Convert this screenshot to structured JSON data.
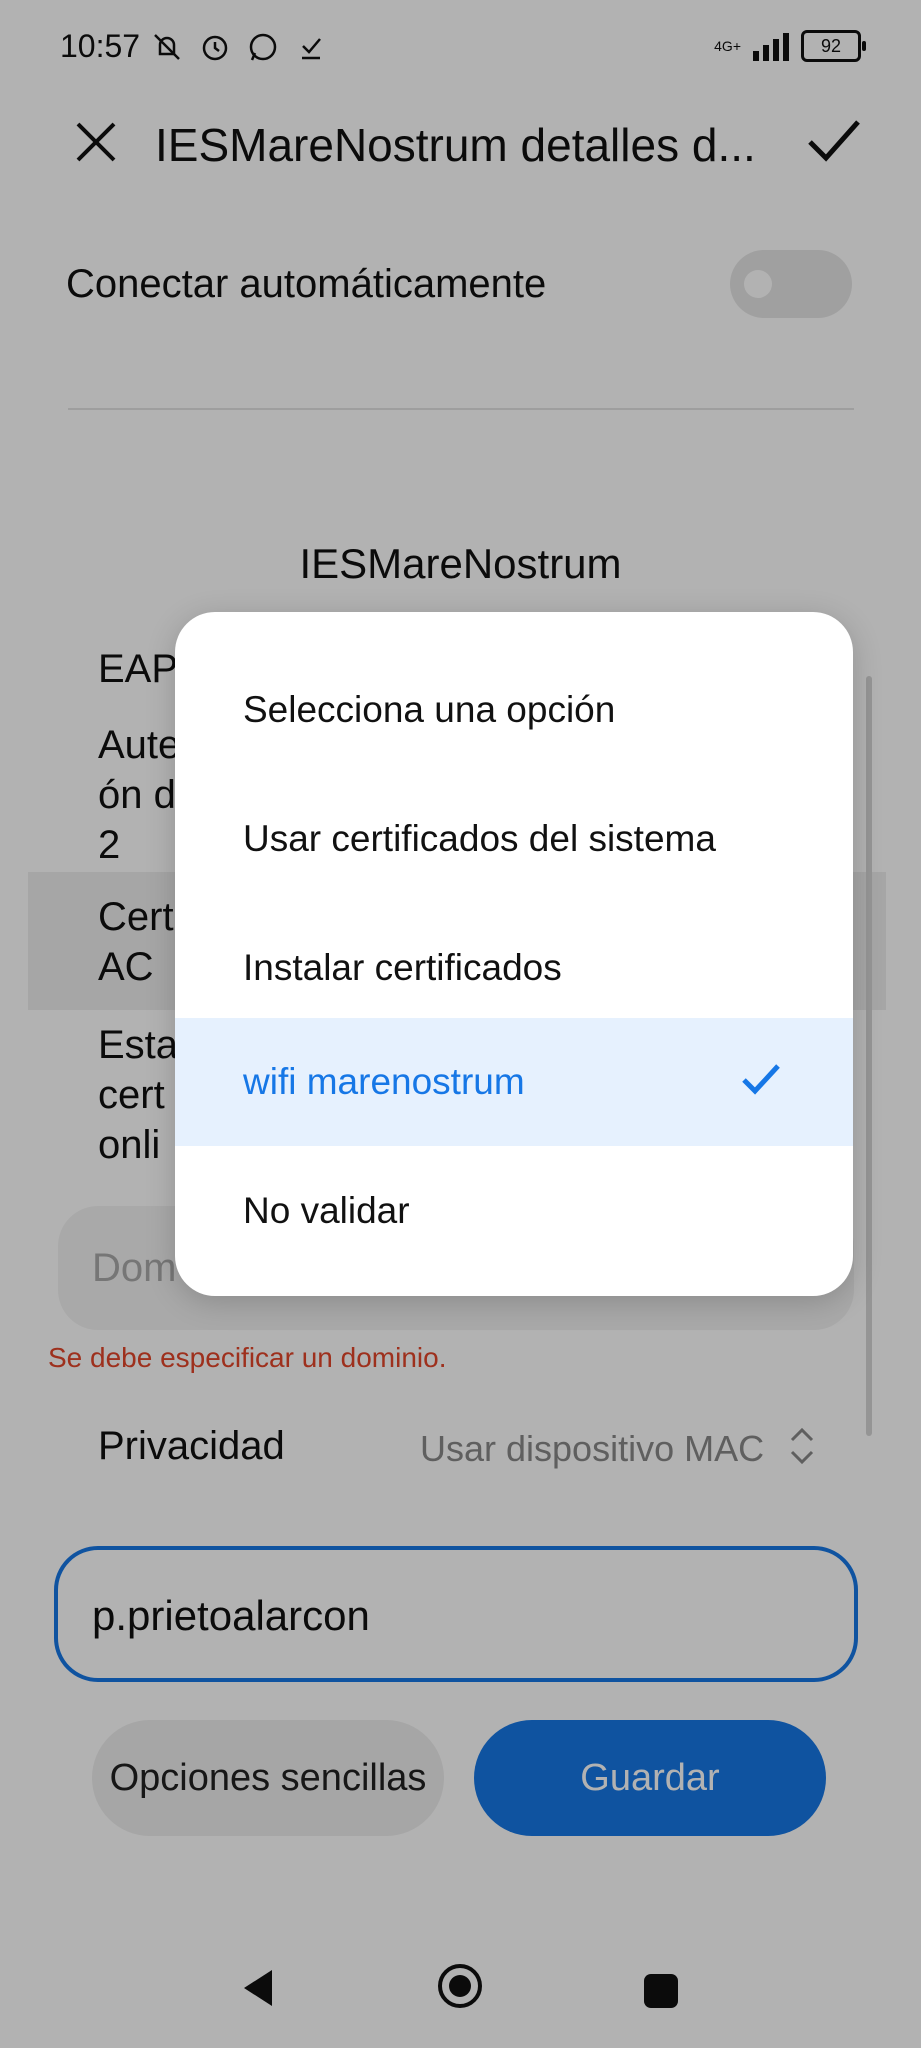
{
  "status_bar": {
    "time": "10:57",
    "network": "4G+",
    "battery": "92",
    "icons": [
      "silent-icon",
      "alarm-icon",
      "whatsapp-icon",
      "download-done-icon"
    ]
  },
  "header": {
    "title": "IESMareNostrum detalles d..."
  },
  "auto_connect": {
    "label": "Conectar automáticamente",
    "enabled": false
  },
  "ssid": "IESMareNostrum",
  "background_rows": {
    "eap": "EAP",
    "auth_line1": "Aute",
    "auth_line2": "ón d",
    "auth_line3": "2",
    "cert_line1": "Cert",
    "cert_line2": "AC",
    "status_line1": "Esta",
    "status_line2": "cert",
    "status_line3": "onli"
  },
  "domain": {
    "placeholder": "Dom",
    "error": "Se debe especificar un dominio."
  },
  "privacy": {
    "label": "Privacidad",
    "value": "Usar dispositivo MAC"
  },
  "identity": {
    "value": "p.prietoalarcon"
  },
  "buttons": {
    "simple": "Opciones sencillas",
    "save": "Guardar"
  },
  "dialog": {
    "options": [
      {
        "label": "Selecciona una opción",
        "selected": false
      },
      {
        "label": "Usar certificados del sistema",
        "selected": false
      },
      {
        "label": "Instalar certificados",
        "selected": false
      },
      {
        "label": "wifi marenostrum",
        "selected": true
      },
      {
        "label": "No validar",
        "selected": false
      }
    ]
  },
  "colors": {
    "accent": "#1677e6",
    "error": "#e2462a",
    "selected_bg": "#e6f1fe"
  }
}
